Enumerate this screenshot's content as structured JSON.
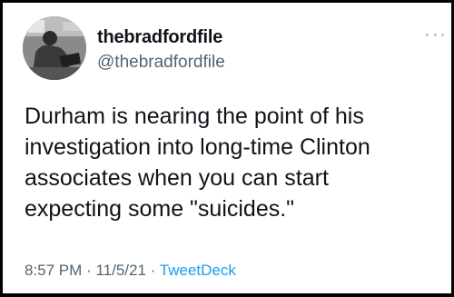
{
  "author": {
    "display_name": "thebradfordfile",
    "handle": "@thebradfordfile"
  },
  "tweet": {
    "text": "Durham is nearing the point of his investigation into long-time Clinton associates when you can start expecting some \"suicides.\"",
    "time": "8:57 PM",
    "separator_1": "·",
    "date": "11/5/21",
    "separator_2": "·",
    "source": "TweetDeck"
  },
  "icons": {
    "more": "more-options-icon",
    "avatar": "profile-avatar"
  },
  "colors": {
    "text_primary": "#0f1419",
    "text_secondary": "#536471",
    "link": "#1d9bf0",
    "border": "#000000"
  }
}
